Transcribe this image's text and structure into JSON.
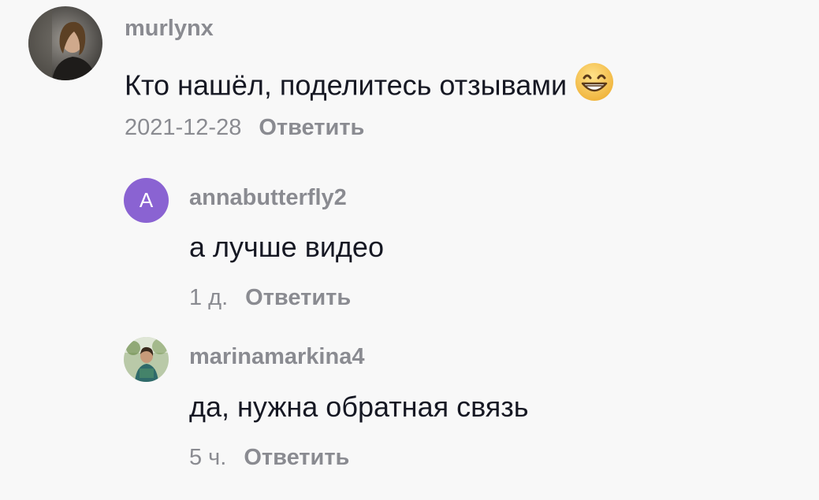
{
  "comments": [
    {
      "username": "murlynx",
      "text": "Кто нашёл, поделитесь отзывами",
      "emoji": "grinning-face-with-smiling-eyes",
      "time": "2021-12-28",
      "reply_label": "Ответить"
    },
    {
      "avatar_letter": "A",
      "username": "annabutterfly2",
      "text": "а лучше видео",
      "time": "1 д.",
      "reply_label": "Ответить"
    },
    {
      "username": "marinamarkina4",
      "text": "да, нужна обратная связь",
      "time": "5 ч.",
      "reply_label": "Ответить"
    }
  ],
  "colors": {
    "background": "#f8f8f8",
    "username": "#8a8b91",
    "text": "#161823",
    "avatar_letter_bg": "#8a63d2"
  }
}
